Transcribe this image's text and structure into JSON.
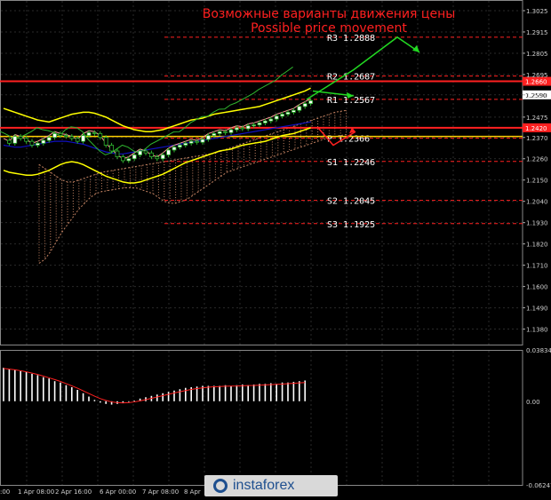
{
  "header": {
    "title_ru": "Возможные варианты движения цены",
    "title_en": "Possible price movement"
  },
  "watermark": {
    "text": "instaforex",
    "icon": "instaforex-logo-icon"
  },
  "colors": {
    "background": "#000000",
    "grid": "#2a2a2a",
    "candle": "#2fb52f",
    "bollinger": "#ffff00",
    "moving_average": "#1010c0",
    "kijun": "#ff9a9a",
    "level_line": "#ff2020",
    "pivot_line": "#ffd000",
    "arrow_up": "#22d822",
    "arrow_down": "#ff2020",
    "macd_bar": "#ffffff",
    "macd_signal": "#ff2020",
    "cloud": "#c08060"
  },
  "chart_data": [
    {
      "type": "line",
      "name": "price",
      "x_labels": [
        "1 Apr 08:00",
        "2 Apr 16:00",
        "6 Apr 00:00",
        "7 Apr 08:00",
        "8 Apr"
      ],
      "x_labels_partial": [
        ":00"
      ],
      "y_ticks": [
        "1.3025",
        "1.2915",
        "1.2805",
        "1.2695",
        "1.2590",
        "1.2475",
        "1.2370",
        "1.2260",
        "1.2150",
        "1.2040",
        "1.1930",
        "1.1820",
        "1.1710",
        "1.1600",
        "1.1490",
        "1.1380"
      ],
      "ylim": [
        1.13,
        1.308
      ],
      "price_series": [
        1.2355,
        1.234,
        1.2375,
        1.2365,
        1.235,
        1.233,
        1.234,
        1.2355,
        1.237,
        1.239,
        1.238,
        1.2375,
        1.2365,
        1.235,
        1.238,
        1.2395,
        1.239,
        1.237,
        1.233,
        1.23,
        1.227,
        1.225,
        1.226,
        1.228,
        1.23,
        1.229,
        1.227,
        1.226,
        1.228,
        1.2305,
        1.232,
        1.233,
        1.234,
        1.235,
        1.2345,
        1.236,
        1.238,
        1.239,
        1.24,
        1.2395,
        1.241,
        1.242,
        1.2415,
        1.243,
        1.2435,
        1.2445,
        1.2455,
        1.2465,
        1.248,
        1.249,
        1.25,
        1.251,
        1.253,
        1.2545,
        1.256
      ],
      "bollinger_upper": [
        1.252,
        1.251,
        1.25,
        1.249,
        1.248,
        1.247,
        1.246,
        1.2455,
        1.245,
        1.246,
        1.247,
        1.248,
        1.249,
        1.2495,
        1.25,
        1.25,
        1.2495,
        1.2485,
        1.2475,
        1.246,
        1.2445,
        1.243,
        1.242,
        1.241,
        1.2405,
        1.24,
        1.24,
        1.2405,
        1.241,
        1.242,
        1.243,
        1.244,
        1.245,
        1.246,
        1.2465,
        1.247,
        1.248,
        1.249,
        1.2495,
        1.25,
        1.2505,
        1.251,
        1.2515,
        1.252,
        1.2525,
        1.253,
        1.254,
        1.255,
        1.256,
        1.257,
        1.258,
        1.259,
        1.26,
        1.261,
        1.2625
      ],
      "bollinger_lower": [
        1.22,
        1.219,
        1.2185,
        1.218,
        1.2175,
        1.2175,
        1.218,
        1.219,
        1.22,
        1.2215,
        1.223,
        1.224,
        1.2245,
        1.224,
        1.223,
        1.2215,
        1.22,
        1.2185,
        1.217,
        1.216,
        1.215,
        1.214,
        1.2135,
        1.2135,
        1.214,
        1.215,
        1.216,
        1.217,
        1.218,
        1.2195,
        1.221,
        1.2225,
        1.224,
        1.225,
        1.226,
        1.227,
        1.228,
        1.229,
        1.23,
        1.2305,
        1.231,
        1.232,
        1.233,
        1.2335,
        1.234,
        1.2345,
        1.235,
        1.236,
        1.237,
        1.238,
        1.2385,
        1.239,
        1.24,
        1.241,
        1.242
      ],
      "moving_average": [
        1.233,
        1.2325,
        1.232,
        1.232,
        1.2325,
        1.233,
        1.2335,
        1.234,
        1.2345,
        1.235,
        1.235,
        1.235,
        1.2345,
        1.234,
        1.2335,
        1.2325,
        1.2315,
        1.2305,
        1.2295,
        1.229,
        1.2285,
        1.2285,
        1.229,
        1.2295,
        1.23,
        1.2305,
        1.231,
        1.2315,
        1.232,
        1.2325,
        1.233,
        1.2335,
        1.234,
        1.2345,
        1.235,
        1.2355,
        1.236,
        1.2365,
        1.237,
        1.2375,
        1.238,
        1.2385,
        1.239,
        1.2395,
        1.24,
        1.2405,
        1.241,
        1.2415,
        1.242,
        1.2425,
        1.243,
        1.2435,
        1.244,
        1.2445,
        1.245
      ],
      "cloud_top": [
        1.223,
        1.221,
        1.219,
        1.217,
        1.215,
        1.214,
        1.214,
        1.215,
        1.216,
        1.217,
        1.218,
        1.219,
        1.2195,
        1.22,
        1.2205,
        1.221,
        1.2215,
        1.222,
        1.2225,
        1.223,
        1.2235,
        1.224,
        1.2245,
        1.225,
        1.2255,
        1.226,
        1.2265,
        1.227,
        1.2275,
        1.228,
        1.2285,
        1.229,
        1.23,
        1.231,
        1.232,
        1.233,
        1.234,
        1.235,
        1.236,
        1.237,
        1.238,
        1.239,
        1.24,
        1.241,
        1.242,
        1.243,
        1.244,
        1.245,
        1.246,
        1.247,
        1.248,
        1.249,
        1.25,
        1.2505,
        1.251
      ],
      "cloud_bottom": [
        1.172,
        1.174,
        1.178,
        1.183,
        1.188,
        1.192,
        1.196,
        1.2,
        1.203,
        1.206,
        1.208,
        1.209,
        1.2095,
        1.21,
        1.2105,
        1.211,
        1.211,
        1.211,
        1.21,
        1.209,
        1.208,
        1.206,
        1.204,
        1.203,
        1.203,
        1.204,
        1.205,
        1.207,
        1.209,
        1.211,
        1.213,
        1.215,
        1.217,
        1.219,
        1.22,
        1.221,
        1.222,
        1.223,
        1.224,
        1.225,
        1.226,
        1.227,
        1.228,
        1.229,
        1.23,
        1.231,
        1.232,
        1.233,
        1.234,
        1.235,
        1.236,
        1.237,
        1.2375,
        1.238,
        1.2385
      ],
      "levels": [
        {
          "label": "R3",
          "value": "1.2888",
          "price": 1.2888
        },
        {
          "label": "R2",
          "value": "1.2687",
          "price": 1.2687
        },
        {
          "label": "R1",
          "value": "1.2567",
          "price": 1.2567
        },
        {
          "label": "P",
          "value": "1.2366",
          "price": 1.2366
        },
        {
          "label": "S1",
          "value": "1.2246",
          "price": 1.2246
        },
        {
          "label": "S2",
          "value": "1.2045",
          "price": 1.2045
        },
        {
          "label": "S3",
          "value": "1.1925",
          "price": 1.1925
        }
      ],
      "horizontal_lines": [
        {
          "price": 1.266,
          "style": "solid-thick",
          "tag": "1.2660"
        },
        {
          "price": 1.242,
          "style": "solid-thick",
          "tag": "1.2420"
        },
        {
          "price": 1.2375,
          "style": "solid-yellow",
          "tag": ""
        }
      ],
      "current_price_tag": "1.2590",
      "forecast_up": {
        "from": 1.2566,
        "via": 1.272,
        "to": 1.2888,
        "end": 1.281
      },
      "forecast_down": {
        "from": 1.242,
        "to": 1.233,
        "end": 1.24
      }
    },
    {
      "type": "bar",
      "name": "macd",
      "y_ticks": [
        "0.03834",
        "0.00",
        "-0.06247"
      ],
      "ylim": [
        -0.06247,
        0.03834
      ],
      "values": [
        0.025,
        0.024,
        0.0235,
        0.0225,
        0.022,
        0.0205,
        0.0195,
        0.018,
        0.017,
        0.015,
        0.014,
        0.012,
        0.0105,
        0.0085,
        0.006,
        0.0035,
        0.001,
        -0.001,
        -0.002,
        -0.0025,
        -0.002,
        -0.0015,
        -0.0005,
        0.0005,
        0.002,
        0.003,
        0.004,
        0.005,
        0.006,
        0.007,
        0.008,
        0.009,
        0.01,
        0.0105,
        0.011,
        0.0115,
        0.0115,
        0.0115,
        0.0115,
        0.012,
        0.0115,
        0.012,
        0.0125,
        0.012,
        0.0125,
        0.013,
        0.013,
        0.0135,
        0.013,
        0.014,
        0.014,
        0.0145,
        0.015,
        0.0155
      ],
      "signal": [
        0.0245,
        0.024,
        0.0235,
        0.0228,
        0.022,
        0.021,
        0.02,
        0.0188,
        0.0175,
        0.0162,
        0.0148,
        0.0132,
        0.0115,
        0.0098,
        0.0078,
        0.0058,
        0.0038,
        0.002,
        0.0006,
        -0.0005,
        -0.001,
        -0.0012,
        -0.001,
        -0.0005,
        0.0003,
        0.0012,
        0.0022,
        0.0032,
        0.0042,
        0.0052,
        0.0062,
        0.0071,
        0.008,
        0.0088,
        0.0095,
        0.01,
        0.0105,
        0.0108,
        0.011,
        0.0112,
        0.0113,
        0.0114,
        0.0116,
        0.0117,
        0.0118,
        0.012,
        0.0122,
        0.0124,
        0.0126,
        0.0128,
        0.0131,
        0.0134,
        0.0137,
        0.014
      ]
    }
  ]
}
